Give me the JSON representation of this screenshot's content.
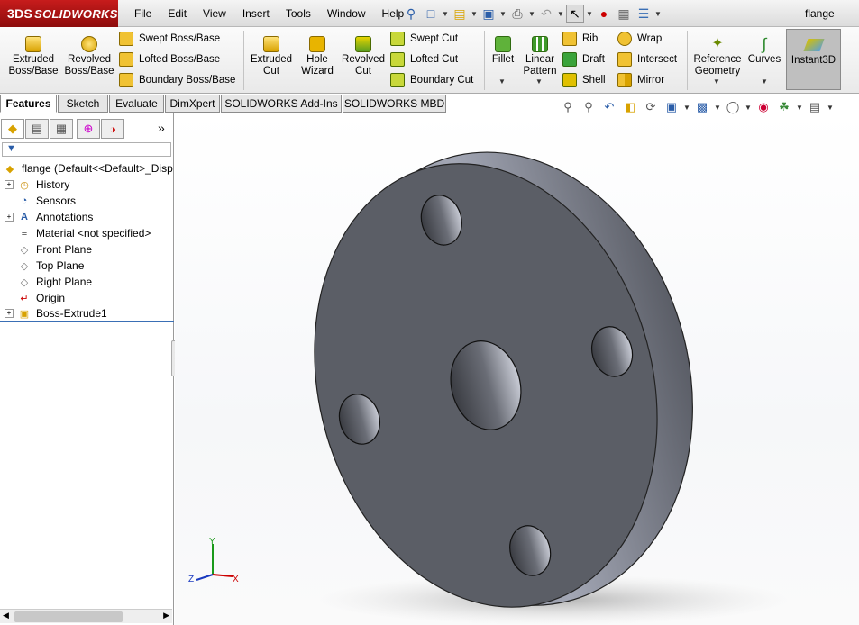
{
  "app": {
    "brand": "SOLIDWORKS",
    "brand_prefix": "3DS",
    "document_title": "flange"
  },
  "menu": [
    "File",
    "Edit",
    "View",
    "Insert",
    "Tools",
    "Window",
    "Help"
  ],
  "features": {
    "extruded_boss": "Extruded\nBoss/Base",
    "revolved_boss": "Revolved\nBoss/Base",
    "swept_boss": "Swept Boss/Base",
    "lofted_boss": "Lofted Boss/Base",
    "boundary_boss": "Boundary Boss/Base",
    "extruded_cut": "Extruded\nCut",
    "hole_wizard": "Hole\nWizard",
    "revolved_cut": "Revolved\nCut",
    "swept_cut": "Swept Cut",
    "lofted_cut": "Lofted Cut",
    "boundary_cut": "Boundary Cut",
    "fillet": "Fillet",
    "linear_pattern": "Linear\nPattern",
    "rib": "Rib",
    "draft": "Draft",
    "shell": "Shell",
    "wrap": "Wrap",
    "intersect": "Intersect",
    "mirror": "Mirror",
    "reference_geometry": "Reference\nGeometry",
    "curves": "Curves",
    "instant3d": "Instant3D"
  },
  "tabs": [
    "Features",
    "Sketch",
    "Evaluate",
    "DimXpert",
    "SOLIDWORKS Add-Ins",
    "SOLIDWORKS MBD"
  ],
  "active_tab": "Features",
  "tree": {
    "root": "flange  (Default<<Default>_Disp",
    "items": [
      {
        "label": "History",
        "expandable": true,
        "icon": "history-icon"
      },
      {
        "label": "Sensors",
        "expandable": false,
        "icon": "sensors-icon"
      },
      {
        "label": "Annotations",
        "expandable": true,
        "icon": "annotations-icon"
      },
      {
        "label": "Material <not specified>",
        "expandable": false,
        "icon": "material-icon"
      },
      {
        "label": "Front Plane",
        "expandable": false,
        "icon": "plane-icon"
      },
      {
        "label": "Top Plane",
        "expandable": false,
        "icon": "plane-icon"
      },
      {
        "label": "Right Plane",
        "expandable": false,
        "icon": "plane-icon"
      },
      {
        "label": "Origin",
        "expandable": false,
        "icon": "origin-icon"
      },
      {
        "label": "Boss-Extrude1",
        "expandable": true,
        "icon": "boss-extrude-icon"
      }
    ]
  },
  "axes": {
    "x": "X",
    "y": "Y",
    "z": "Z"
  },
  "colors": {
    "brand_red": "#b3121a",
    "model_face": "#5b5e66",
    "model_edge": "#8f93a0",
    "active_row_line": "#3a6fb5"
  }
}
